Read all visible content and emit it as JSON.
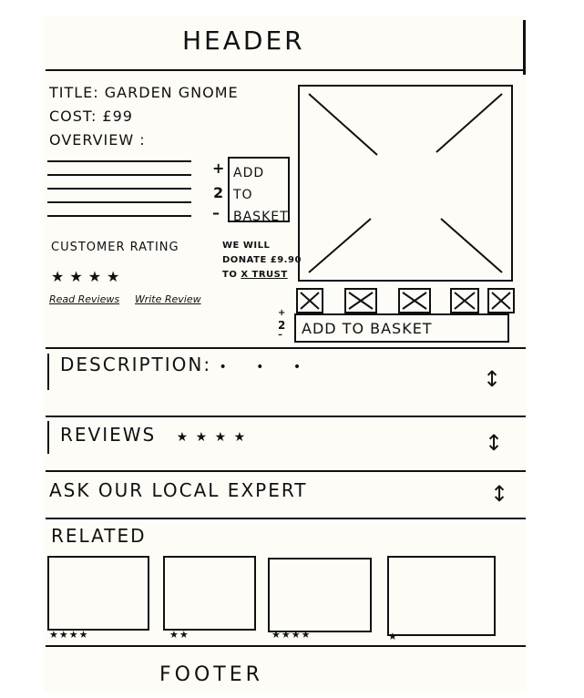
{
  "header": {
    "title": "HEADER"
  },
  "product": {
    "title_label": "TITLE:",
    "title_value": "GARDEN GNOME",
    "cost_label": "COST:",
    "cost_value": "£99",
    "overview_label": "OVERVIEW :"
  },
  "quantity": {
    "plus": "+",
    "value": "2",
    "minus": "–"
  },
  "add_to_basket_small": {
    "line1": "ADD TO",
    "line2": "BASKET"
  },
  "rating": {
    "label": "CUSTOMER RATING",
    "stars": "★★★★",
    "read_reviews": "Read Reviews",
    "write_review": "Write Review"
  },
  "donation": {
    "line1": "WE WILL",
    "line2": "DONATE £9.90",
    "line3_prefix": "TO",
    "line3_charity": "X TRUST"
  },
  "main_image": {
    "icon": "image-placeholder-icon"
  },
  "thumbnails": [
    "thumb-1",
    "thumb-2",
    "thumb-3",
    "thumb-4",
    "thumb-5"
  ],
  "add_to_basket_wide": {
    "qty_top": "+",
    "qty_value": "2",
    "qty_bottom": "–",
    "label": "ADD TO BASKET"
  },
  "accordion": [
    {
      "label": "DESCRIPTION:",
      "extra": "• • •"
    },
    {
      "label": "REVIEWS",
      "extra": "★ ★ ★ ★"
    },
    {
      "label": "ASK OUR LOCAL EXPERT",
      "extra": ""
    }
  ],
  "related": {
    "title": "RELATED",
    "items": [
      {
        "rating": "★★★★"
      },
      {
        "rating": "★★"
      },
      {
        "rating": "★★★★"
      },
      {
        "rating": "★"
      }
    ]
  },
  "footer": {
    "title": "FOOTER"
  }
}
